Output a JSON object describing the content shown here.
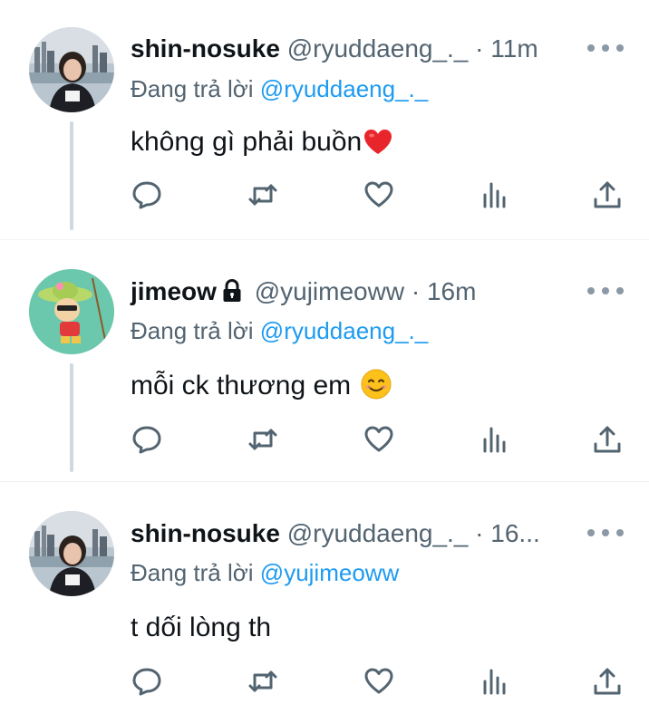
{
  "tweets": [
    {
      "name": "shin-nosuke",
      "handle": "@ryuddaeng_._",
      "time": "· 11m",
      "reply_prefix": "Đang trả lời",
      "reply_to": "@ryuddaeng_._",
      "text": "không gì phải buồn",
      "emoji": "red-heart",
      "locked": false
    },
    {
      "name": "jimeow",
      "handle": "@yujimeoww",
      "time": "· 16m",
      "reply_prefix": "Đang trả lời",
      "reply_to": "@ryuddaeng_._",
      "text": "mỗi ck thương em",
      "emoji": "smiling-face",
      "locked": true
    },
    {
      "name": "shin-nosuke",
      "handle": "@ryuddaeng_._",
      "time": "· 16...",
      "reply_prefix": "Đang trả lời",
      "reply_to": "@yujimeoww",
      "text": "t dối lòng th",
      "emoji": "",
      "locked": false
    }
  ],
  "actions": [
    "reply-icon",
    "retweet-icon",
    "like-icon",
    "views-icon",
    "share-icon"
  ],
  "colors": {
    "link": "#1d9bf0",
    "secondary_text": "#536471",
    "thread_line": "#cfd9de",
    "icon": "#536471"
  }
}
